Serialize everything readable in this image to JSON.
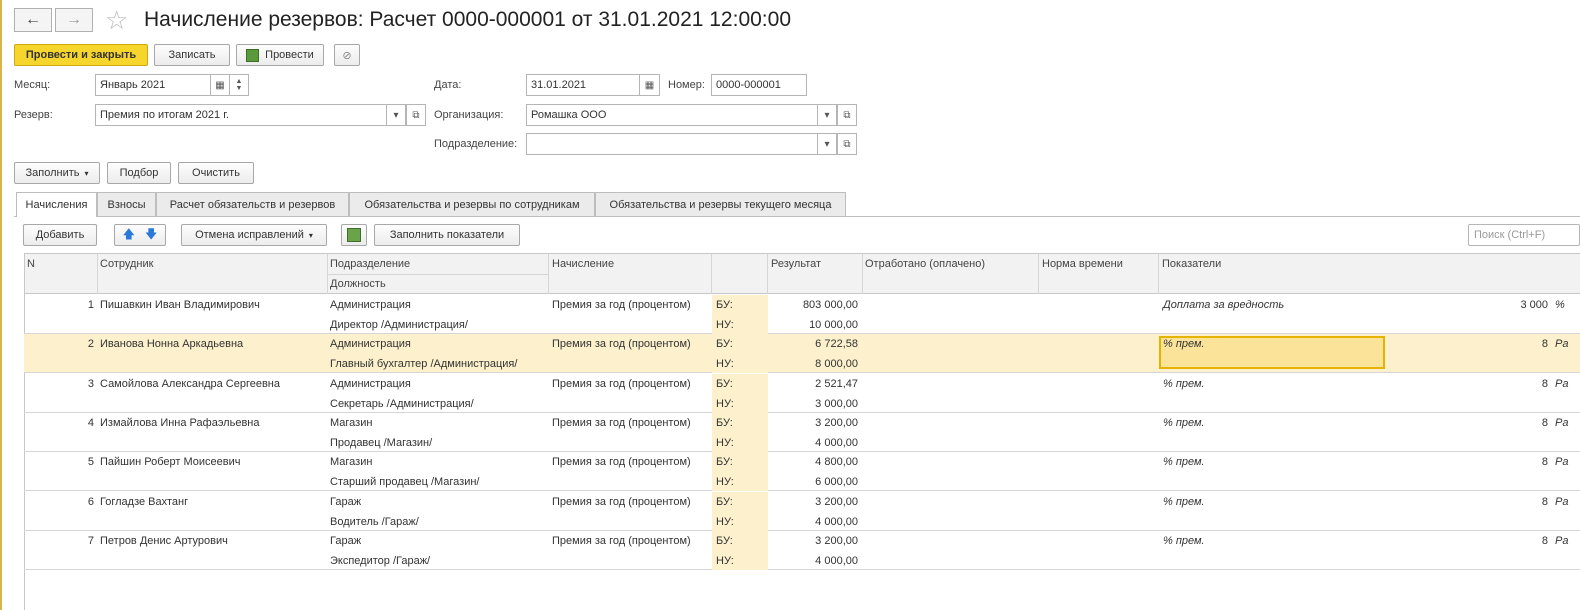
{
  "window": {
    "title": "Начисление резервов: Расчет 0000-000001 от 31.01.2021 12:00:00",
    "back_icon": "←",
    "forward_icon": "→",
    "star_icon": "☆"
  },
  "toolbar": {
    "post_close": "Провести и закрыть",
    "save": "Записать",
    "post": "Провести",
    "attach_icon": "⊘"
  },
  "form": {
    "month_label": "Месяц:",
    "month_value": "Январь 2021",
    "date_label": "Дата:",
    "date_value": "31.01.2021",
    "number_label": "Номер:",
    "number_value": "0000-000001",
    "reserve_label": "Резерв:",
    "reserve_value": "Премия по итогам 2021 г.",
    "org_label": "Организация:",
    "org_value": "Ромашка ООО",
    "dept_label": "Подразделение:",
    "dept_value": ""
  },
  "actions": {
    "fill": "Заполнить",
    "pick": "Подбор",
    "clear": "Очистить"
  },
  "tabs": [
    {
      "label": "Начисления"
    },
    {
      "label": "Взносы"
    },
    {
      "label": "Расчет обязательств и резервов"
    },
    {
      "label": "Обязательства и резервы по сотрудникам"
    },
    {
      "label": "Обязательства и резервы текущего месяца"
    }
  ],
  "table_toolbar": {
    "add": "Добавить",
    "cancel_corrections": "Отмена исправлений",
    "fill_indicators": "Заполнить показатели",
    "search_placeholder": "Поиск (Ctrl+F)"
  },
  "columns": {
    "n": "N",
    "employee": "Сотрудник",
    "dept": "Подразделение",
    "position": "Должность",
    "accrual": "Начисление",
    "result": "Результат",
    "worked": "Отработано (оплачено)",
    "norm": "Норма времени",
    "indicators": "Показатели"
  },
  "rows": [
    {
      "n": "1",
      "employee": "Пишавкин Иван Владимирович",
      "dept": "Администрация",
      "position": "Директор /Администрация/",
      "accrual": "Премия за год (процентом)",
      "bu": "БУ:",
      "nu": "НУ:",
      "result_bu": "803 000,00",
      "result_nu": "10 000,00",
      "indicator": "Доплата за вредность",
      "ind_value": "3 000",
      "ind_extra": "%"
    },
    {
      "n": "2",
      "employee": "Иванова Нонна Аркадьевна",
      "dept": "Администрация",
      "position": "Главный бухгалтер /Администрация/",
      "accrual": "Премия за год (процентом)",
      "bu": "БУ:",
      "nu": "НУ:",
      "result_bu": "6 722,58",
      "result_nu": "8 000,00",
      "indicator": "% прем.",
      "ind_value": "8",
      "ind_extra": "Ра"
    },
    {
      "n": "3",
      "employee": "Самойлова Александра Сергеевна",
      "dept": "Администрация",
      "position": "Секретарь /Администрация/",
      "accrual": "Премия за год (процентом)",
      "bu": "БУ:",
      "nu": "НУ:",
      "result_bu": "2 521,47",
      "result_nu": "3 000,00",
      "indicator": "% прем.",
      "ind_value": "8",
      "ind_extra": "Ра"
    },
    {
      "n": "4",
      "employee": "Измайлова Инна Рафаэльевна",
      "dept": "Магазин",
      "position": "Продавец /Магазин/",
      "accrual": "Премия за год (процентом)",
      "bu": "БУ:",
      "nu": "НУ:",
      "result_bu": "3 200,00",
      "result_nu": "4 000,00",
      "indicator": "% прем.",
      "ind_value": "8",
      "ind_extra": "Ра"
    },
    {
      "n": "5",
      "employee": "Пайшин Роберт Моисеевич",
      "dept": "Магазин",
      "position": "Старший продавец /Магазин/",
      "accrual": "Премия за год (процентом)",
      "bu": "БУ:",
      "nu": "НУ:",
      "result_bu": "4 800,00",
      "result_nu": "6 000,00",
      "indicator": "% прем.",
      "ind_value": "8",
      "ind_extra": "Ра"
    },
    {
      "n": "6",
      "employee": "Гогладзе Вахтанг",
      "dept": "Гараж",
      "position": "Водитель /Гараж/",
      "accrual": "Премия за год (процентом)",
      "bu": "БУ:",
      "nu": "НУ:",
      "result_bu": "3 200,00",
      "result_nu": "4 000,00",
      "indicator": "% прем.",
      "ind_value": "8",
      "ind_extra": "Ра"
    },
    {
      "n": "7",
      "employee": "Петров Денис Артурович",
      "dept": "Гараж",
      "position": "Экспедитор /Гараж/",
      "accrual": "Премия за год (процентом)",
      "bu": "БУ:",
      "nu": "НУ:",
      "result_bu": "3 200,00",
      "result_nu": "4 000,00",
      "indicator": "% прем.",
      "ind_value": "8",
      "ind_extra": "Ра"
    }
  ]
}
